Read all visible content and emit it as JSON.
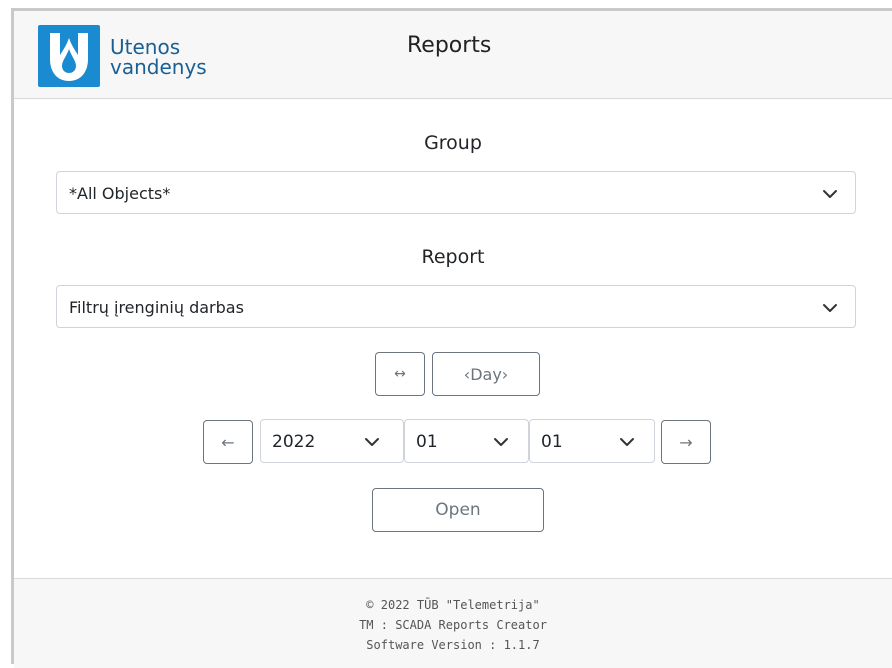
{
  "header": {
    "logo_line1": "Utenos",
    "logo_line2": "vandenys",
    "title": "Reports"
  },
  "group": {
    "label": "Group",
    "selected": "*All Objects*"
  },
  "report": {
    "label": "Report",
    "selected": "Filtrų įrenginių darbas"
  },
  "period": {
    "toggle_label": "↔",
    "mode_label": "‹Day›"
  },
  "date": {
    "prev_label": "←",
    "next_label": "→",
    "year": "2022",
    "month": "01",
    "day": "01"
  },
  "open_label": "Open",
  "footer": {
    "line1": "© 2022 TŪB \"Telemetrija\"",
    "line2": "TM : SCADA Reports Creator",
    "line3": "Software Version : 1.1.7"
  },
  "colors": {
    "brand_blue": "#1a8ad1",
    "brand_text": "#1a5f94"
  },
  "icons": {
    "logo": "water-drop-logo",
    "dropdown": "chevron-down-icon"
  }
}
